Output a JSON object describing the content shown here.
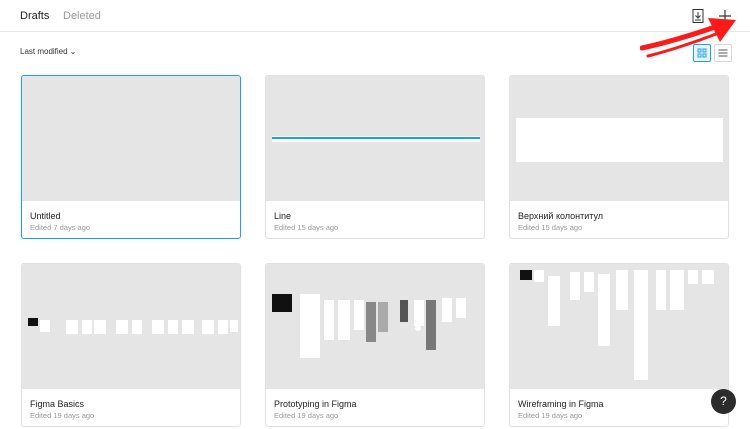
{
  "tabs": {
    "drafts": "Drafts",
    "deleted": "Deleted"
  },
  "toolbar": {
    "import_icon": "import-icon",
    "new_icon": "plus-icon"
  },
  "sort": {
    "label": "Last modified",
    "chevron": "⌄"
  },
  "view": {
    "grid_icon": "grid-view-icon",
    "list_icon": "list-view-icon",
    "active": "grid"
  },
  "files": [
    {
      "title": "Untitled",
      "edited": "Edited 7 days ago",
      "selected": true
    },
    {
      "title": "Line",
      "edited": "Edited 15 days ago"
    },
    {
      "title": "Верхний колонтитул",
      "edited": "Edited 15 days ago"
    },
    {
      "title": "Figma Basics",
      "edited": "Edited 19 days ago"
    },
    {
      "title": "Prototyping in Figma",
      "edited": "Edited 19 days ago"
    },
    {
      "title": "Wireframing in Figma",
      "edited": "Edited 19 days ago"
    }
  ],
  "help": {
    "label": "?"
  },
  "colors": {
    "accent": "#18a0fb",
    "arrow": "#ff1a1a",
    "thumb_bg": "#e5e5e5"
  }
}
